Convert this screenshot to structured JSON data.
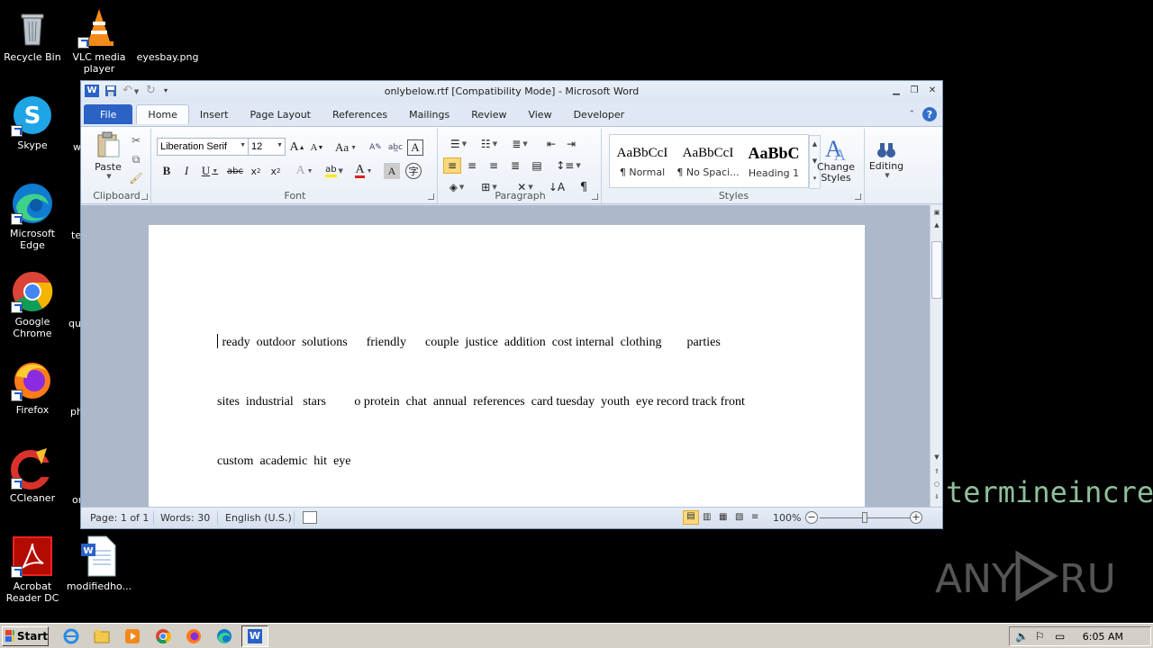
{
  "desktop": {
    "icons": [
      {
        "label": "Recycle Bin"
      },
      {
        "label": "VLC media player"
      },
      {
        "label": "eyesbay.png"
      },
      {
        "label": "Skype"
      },
      {
        "label": "Microsoft Edge"
      },
      {
        "label": "Google Chrome"
      },
      {
        "label": "Firefox"
      },
      {
        "label": "CCleaner"
      },
      {
        "label": "Acrobat Reader DC"
      },
      {
        "label": "modifiedho..."
      }
    ],
    "clipped_labels": [
      "w",
      "te",
      "qu",
      "ph",
      "or"
    ],
    "background_text": "termineincrea",
    "watermark": "ANY RUN"
  },
  "word": {
    "title": "onlybelow.rtf [Compatibility Mode]  -  Microsoft Word",
    "tabs": [
      "File",
      "Home",
      "Insert",
      "Page Layout",
      "References",
      "Mailings",
      "Review",
      "View",
      "Developer"
    ],
    "active_tab": "Home",
    "ribbon": {
      "clipboard": {
        "label": "Clipboard",
        "paste": "Paste"
      },
      "font": {
        "label": "Font",
        "family": "Liberation Serif",
        "size": "12",
        "change_case": "Aa"
      },
      "paragraph": {
        "label": "Paragraph"
      },
      "styles": {
        "label": "Styles",
        "items": [
          {
            "sample": "AaBbCcI",
            "name": "¶ Normal"
          },
          {
            "sample": "AaBbCcI",
            "name": "¶ No Spaci..."
          },
          {
            "sample": "AaBbC",
            "name": "Heading 1"
          }
        ],
        "change_styles": "Change Styles"
      },
      "editing": {
        "label": "Editing"
      }
    },
    "document": {
      "lines": [
        " ready  outdoor  solutions      friendly      couple  justice  addition  cost internal  clothing        parties",
        "sites  industrial   stars         o protein  chat  annual  references  card tuesday  youth  eye record track front",
        "custom  academic  hit  eye"
      ]
    },
    "status": {
      "page": "Page: 1 of 1",
      "words": "Words: 30",
      "language": "English (U.S.)",
      "zoom": "100%",
      "zoom_level": 0.5
    }
  },
  "taskbar": {
    "start": "Start",
    "clock": "6:05 AM"
  },
  "colors": {
    "file_tab": "#2a62c6",
    "ribbon_bg": "#fbfcfe",
    "doc_bg": "#adb9cb",
    "taskbar": "#d4d0c8"
  }
}
